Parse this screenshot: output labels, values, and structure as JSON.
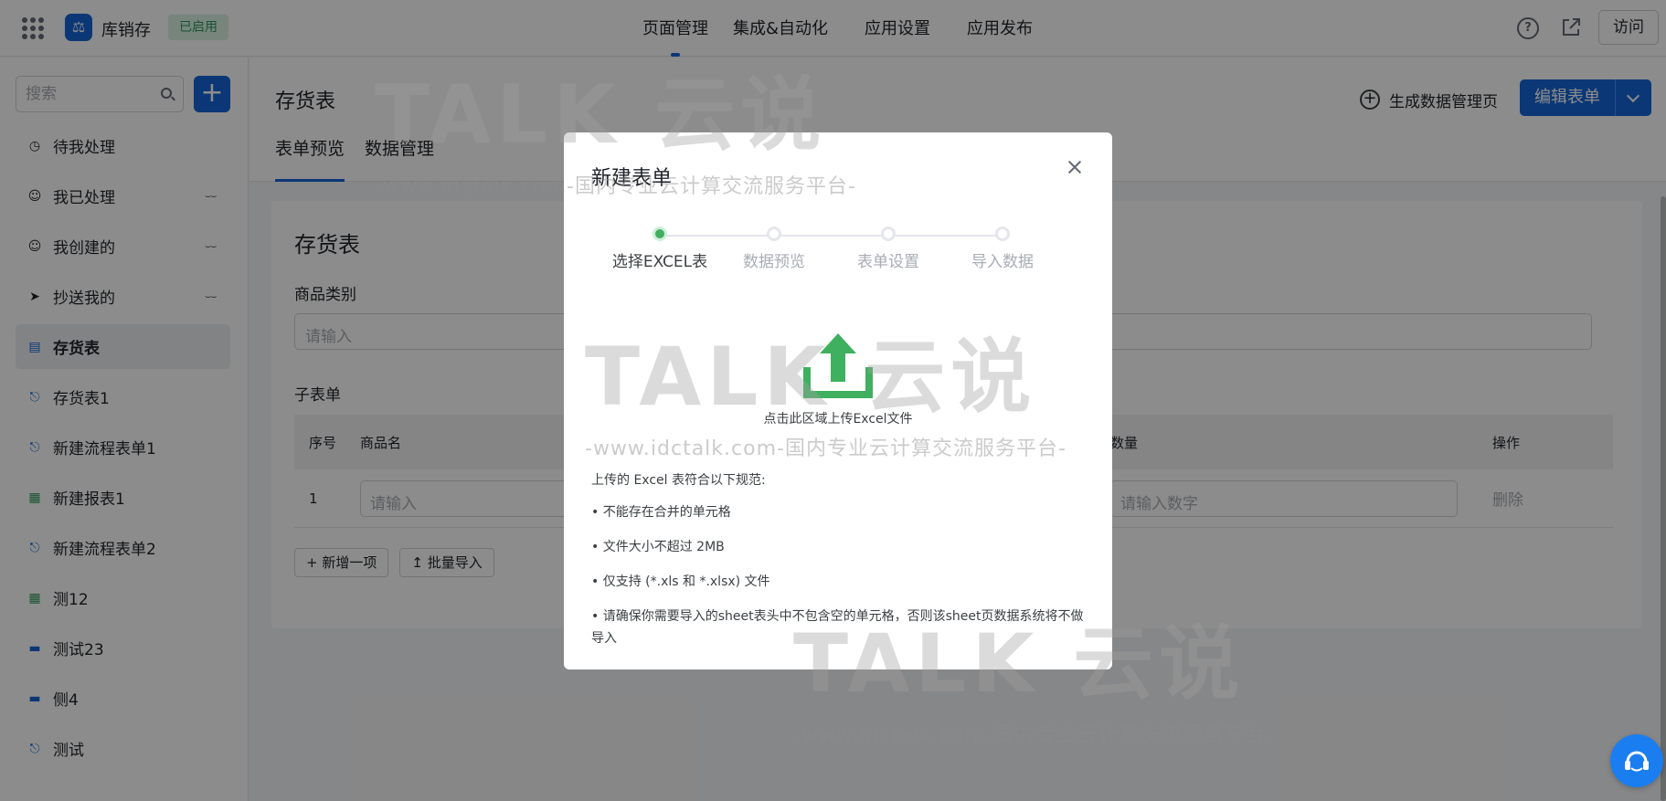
{
  "app": {
    "name": "库销存",
    "status": "已启用",
    "logo_icon": "bank-icon"
  },
  "top_tabs": [
    "页面管理",
    "集成&自动化",
    "应用设置",
    "应用发布"
  ],
  "top_actions": {
    "visit": "访问",
    "help_icon": "help-circle-icon",
    "share_icon": "external-link-icon"
  },
  "sidebar": {
    "search_placeholder": "搜索",
    "items": [
      {
        "label": "待我处理",
        "icon": "clock-icon"
      },
      {
        "label": "我已处理",
        "icon": "user-check-icon"
      },
      {
        "label": "我创建的",
        "icon": "user-icon"
      },
      {
        "label": "抄送我的",
        "icon": "send-icon"
      },
      {
        "label": "存货表",
        "icon": "document-icon"
      },
      {
        "label": "存货表1",
        "icon": "flow-icon"
      },
      {
        "label": "新建流程表单1",
        "icon": "flow-icon"
      },
      {
        "label": "新建报表1",
        "icon": "report-icon"
      },
      {
        "label": "新建流程表单2",
        "icon": "flow-icon"
      },
      {
        "label": "测12",
        "icon": "report-icon"
      },
      {
        "label": "测试23",
        "icon": "folder-icon"
      },
      {
        "label": "侧4",
        "icon": "folder-icon"
      },
      {
        "label": "测试",
        "icon": "flow-icon"
      }
    ]
  },
  "header": {
    "title": "存货表",
    "tabs": [
      "表单预览",
      "数据管理"
    ],
    "gen_page": "生成数据管理页",
    "edit_form": "编辑表单"
  },
  "form": {
    "title": "存货表",
    "field_label": "商品类别",
    "field_placeholder": "请输入",
    "sub_label": "子表单",
    "columns": {
      "idx": "序号",
      "name": "商品名",
      "qty": "数量",
      "op": "操作"
    },
    "row": {
      "idx": "1",
      "name_placeholder": "请输入",
      "qty_placeholder": "请输入数字",
      "delete": "删除"
    },
    "add_row": "新增一项",
    "batch_import": "批量导入"
  },
  "modal": {
    "title": "新建表单",
    "steps": [
      "选择EXCEL表",
      "数据预览",
      "表单设置",
      "导入数据"
    ],
    "active_step": 1,
    "upload_hint": "点击此区域上传Excel文件",
    "rules_title": "上传的 Excel 表符合以下规范:",
    "rules": [
      "• 不能存在合并的单元格",
      "• 文件大小不超过 2MB",
      "• 仅支持 (*.xls 和 *.xlsx) 文件",
      "• 请确保你需要导入的sheet表头中不包含空的单元格，否则该sheet页数据系统将不做导入"
    ]
  },
  "watermark": {
    "logo": "TALK 云说",
    "url": "-www.idctalk.com-国内专业云计算交流服务平台-"
  },
  "colors": {
    "primary": "#1565d8",
    "success": "#3fb05f",
    "overlay": "rgba(0,0,0,0.45)"
  }
}
